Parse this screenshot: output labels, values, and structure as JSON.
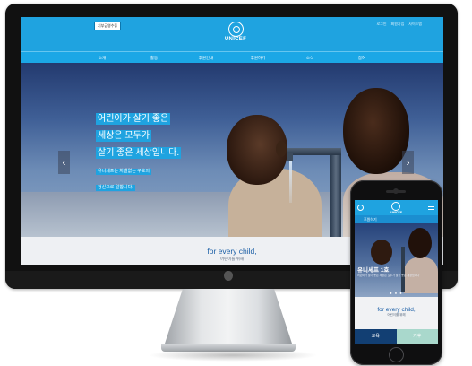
{
  "desktop": {
    "header": {
      "donate_button": "기부금영수증",
      "util_links": [
        "로그인",
        "회원가입",
        "사이트맵"
      ],
      "brand": "UNICEF"
    },
    "nav": [
      "소개",
      "활동",
      "후원안내",
      "후원하기",
      "소식",
      "참여"
    ],
    "hero": {
      "headline_lines": [
        "어린이가 살기 좋은",
        "세상은 모두가",
        "살기 좋은 세상입니다."
      ],
      "sub_lines": [
        "유니세프는 차별없는 구호의",
        "정신으로 일합니다."
      ],
      "prev_arrow": "‹",
      "next_arrow": "›"
    },
    "below": {
      "title": "for every child,",
      "subtitle": "어린이를 위해"
    }
  },
  "mobile": {
    "header": {
      "brand": "UNICEF"
    },
    "nav_label": "후원하기",
    "hero": {
      "headline": "유니세프 1호",
      "sub": "어린이가 살기 좋은 세상은 모두가 살기 좋은 세상입니다",
      "dots": "● ● ●"
    },
    "below": {
      "title": "for every child,",
      "subtitle": "어린이를 위해"
    },
    "tiles": [
      "교육",
      "기후"
    ]
  },
  "colors": {
    "unicef_blue": "#1fa3e0",
    "dark_navy": "#123f73",
    "mint": "#a9d8cc"
  }
}
